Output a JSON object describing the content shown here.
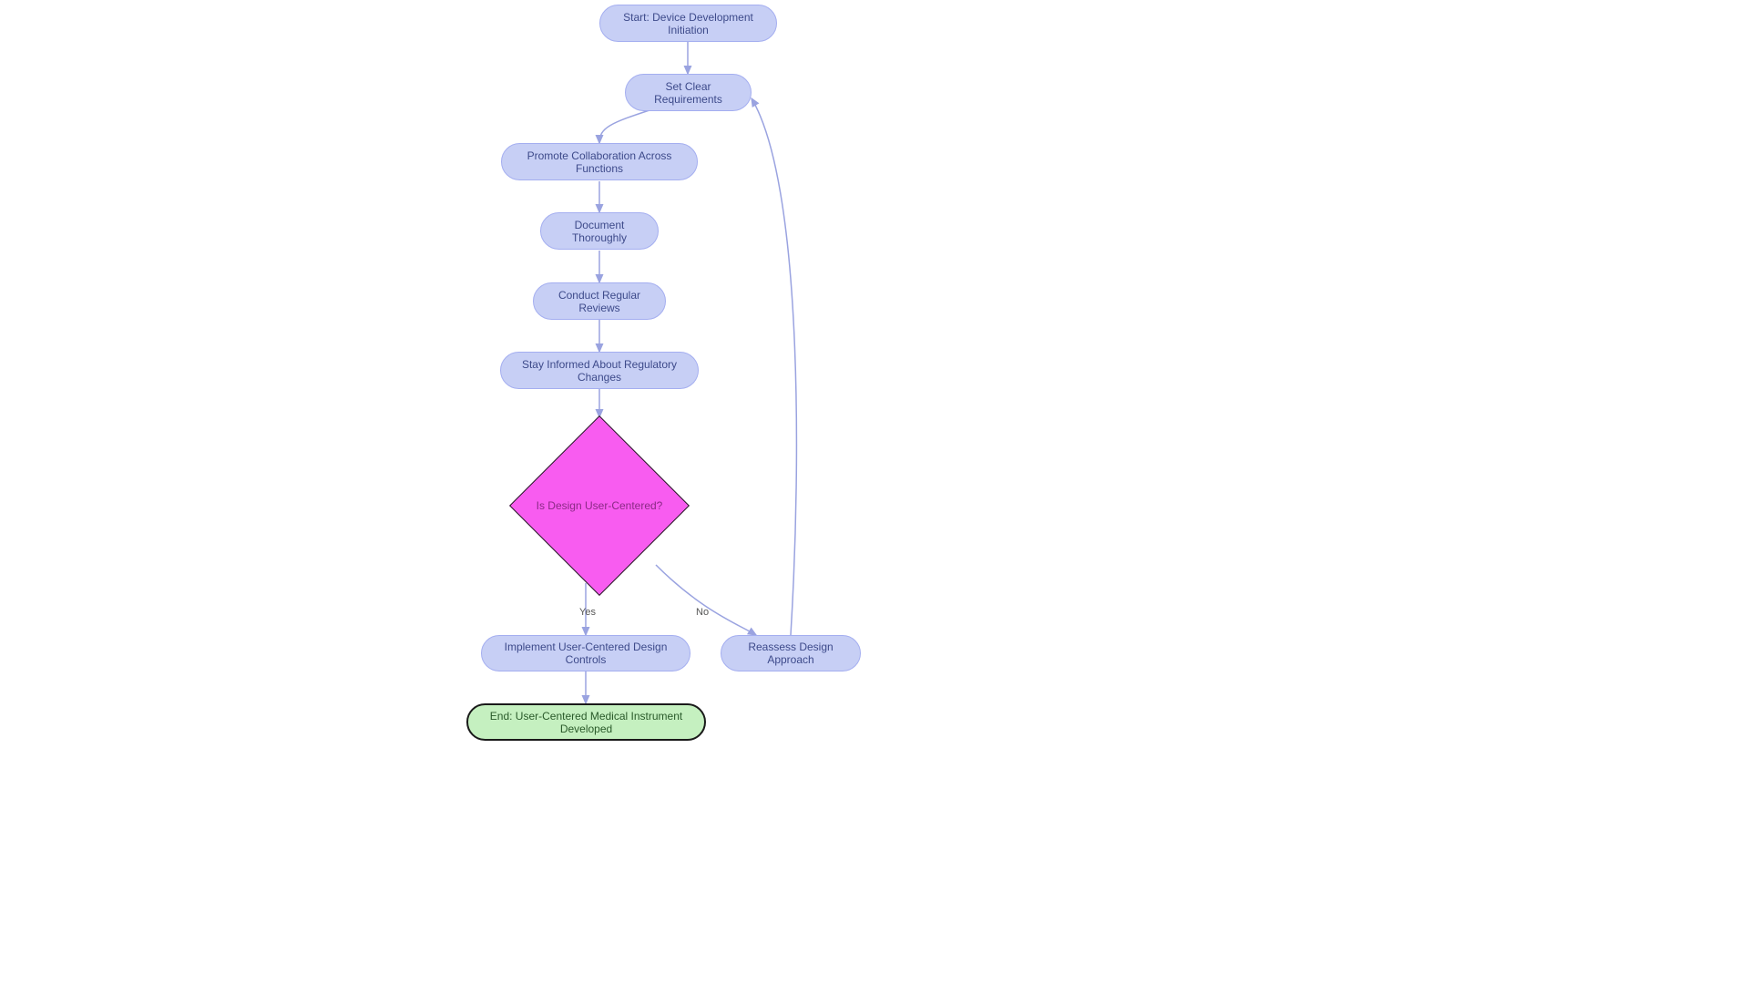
{
  "chart_data": {
    "type": "flowchart",
    "nodes": [
      {
        "id": "start",
        "label": "Start: Device Development Initiation",
        "shape": "pill"
      },
      {
        "id": "req",
        "label": "Set Clear Requirements",
        "shape": "pill"
      },
      {
        "id": "collab",
        "label": "Promote Collaboration Across Functions",
        "shape": "pill"
      },
      {
        "id": "doc",
        "label": "Document Thoroughly",
        "shape": "pill"
      },
      {
        "id": "review",
        "label": "Conduct Regular Reviews",
        "shape": "pill"
      },
      {
        "id": "reg",
        "label": "Stay Informed About Regulatory Changes",
        "shape": "pill"
      },
      {
        "id": "dec",
        "label": "Is Design User-Centered?",
        "shape": "decision"
      },
      {
        "id": "impl",
        "label": "Implement User-Centered Design Controls",
        "shape": "pill"
      },
      {
        "id": "reassess",
        "label": "Reassess Design Approach",
        "shape": "pill"
      },
      {
        "id": "end",
        "label": "End: User-Centered Medical Instrument Developed",
        "shape": "end"
      }
    ],
    "edges": [
      {
        "from": "start",
        "to": "req",
        "label": ""
      },
      {
        "from": "req",
        "to": "collab",
        "label": ""
      },
      {
        "from": "collab",
        "to": "doc",
        "label": ""
      },
      {
        "from": "doc",
        "to": "review",
        "label": ""
      },
      {
        "from": "review",
        "to": "reg",
        "label": ""
      },
      {
        "from": "reg",
        "to": "dec",
        "label": ""
      },
      {
        "from": "dec",
        "to": "impl",
        "label": "Yes"
      },
      {
        "from": "dec",
        "to": "reassess",
        "label": "No"
      },
      {
        "from": "reassess",
        "to": "req",
        "label": ""
      },
      {
        "from": "impl",
        "to": "end",
        "label": ""
      }
    ]
  },
  "nodes": {
    "start": "Start: Device Development Initiation",
    "req": "Set Clear Requirements",
    "collab": "Promote Collaboration Across Functions",
    "doc": "Document Thoroughly",
    "review": "Conduct Regular Reviews",
    "reg": "Stay Informed About Regulatory Changes",
    "dec": "Is Design User-Centered?",
    "impl": "Implement User-Centered Design Controls",
    "reassess": "Reassess Design Approach",
    "end": "End: User-Centered Medical Instrument Developed"
  },
  "labels": {
    "yes": "Yes",
    "no": "No"
  }
}
